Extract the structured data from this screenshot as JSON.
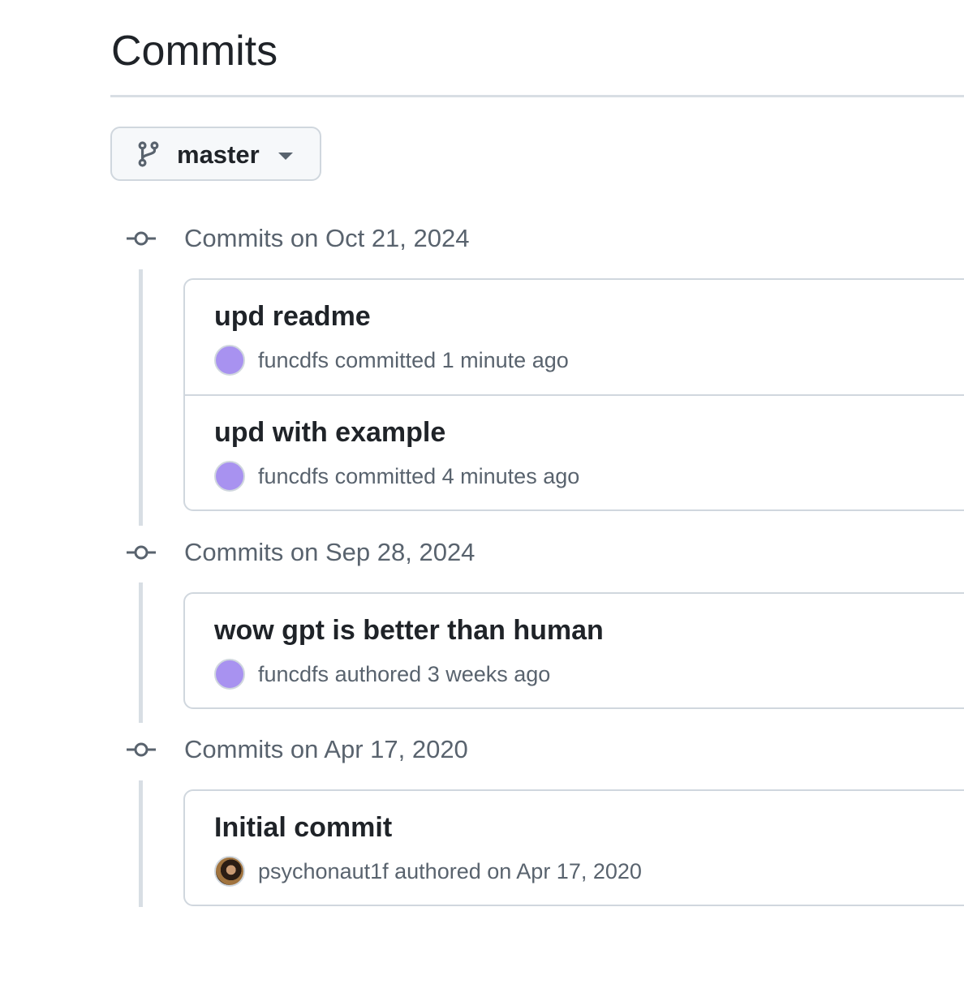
{
  "page": {
    "title": "Commits"
  },
  "branch": {
    "label": "master",
    "icon": "git-branch-icon"
  },
  "groups": [
    {
      "label": "Commits on Oct 21, 2024",
      "commits": [
        {
          "title": "upd readme",
          "author": "funcdfs",
          "action": "committed",
          "time": "1 minute ago",
          "avatar": "purple-circle"
        },
        {
          "title": "upd with example",
          "author": "funcdfs",
          "action": "committed",
          "time": "4 minutes ago",
          "avatar": "purple-circle"
        }
      ]
    },
    {
      "label": "Commits on Sep 28, 2024",
      "commits": [
        {
          "title": "wow gpt is better than human",
          "author": "funcdfs",
          "action": "authored",
          "time": "3 weeks ago",
          "avatar": "purple-circle"
        }
      ]
    },
    {
      "label": "Commits on Apr 17, 2020",
      "commits": [
        {
          "title": "Initial commit",
          "author": "psychonaut1f",
          "action": "authored",
          "time": "on Apr 17, 2020",
          "avatar": "photo"
        }
      ]
    }
  ],
  "colors": {
    "avatar_purple": "#a892f0",
    "muted_text": "#59636e",
    "border": "#d0d7de"
  }
}
